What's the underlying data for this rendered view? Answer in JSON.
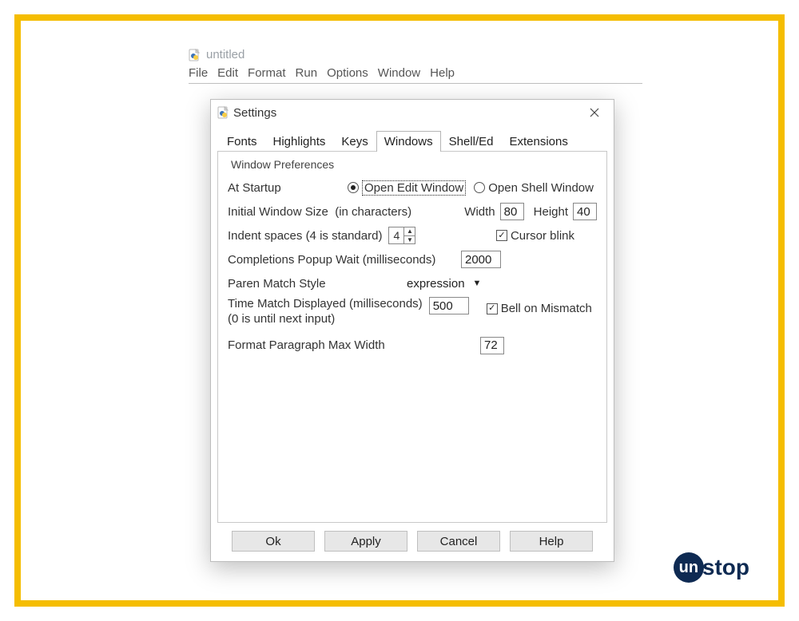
{
  "editor": {
    "title": "untitled",
    "menu": [
      "File",
      "Edit",
      "Format",
      "Run",
      "Options",
      "Window",
      "Help"
    ]
  },
  "dialog": {
    "title": "Settings",
    "tabs": [
      "Fonts",
      "Highlights",
      "Keys",
      "Windows",
      "Shell/Ed",
      "Extensions"
    ],
    "active_tab_index": 3,
    "section_title": "Window Preferences",
    "startup": {
      "label": "At Startup",
      "option_edit": "Open Edit Window",
      "option_shell": "Open Shell Window",
      "selected": "edit"
    },
    "initial_size": {
      "label": "Initial Window Size  (in characters)",
      "width_label": "Width",
      "width_value": "80",
      "height_label": "Height",
      "height_value": "40"
    },
    "indent": {
      "label": "Indent spaces (4 is standard)",
      "value": "4"
    },
    "cursor_blink": {
      "label": "Cursor blink",
      "checked": true
    },
    "completions": {
      "label": "Completions Popup Wait (milliseconds)",
      "value": "2000"
    },
    "paren_match": {
      "label": "Paren Match Style",
      "value": "expression"
    },
    "time_match": {
      "label_line1": "Time Match Displayed (milliseconds)",
      "label_line2": "(0 is until next input)",
      "value": "500"
    },
    "bell_mismatch": {
      "label": "Bell on Mismatch",
      "checked": true
    },
    "format_para": {
      "label": "Format Paragraph Max Width",
      "value": "72"
    },
    "buttons": {
      "ok": "Ok",
      "apply": "Apply",
      "cancel": "Cancel",
      "help": "Help"
    }
  },
  "watermark": {
    "bubble": "un",
    "rest": "stop"
  }
}
